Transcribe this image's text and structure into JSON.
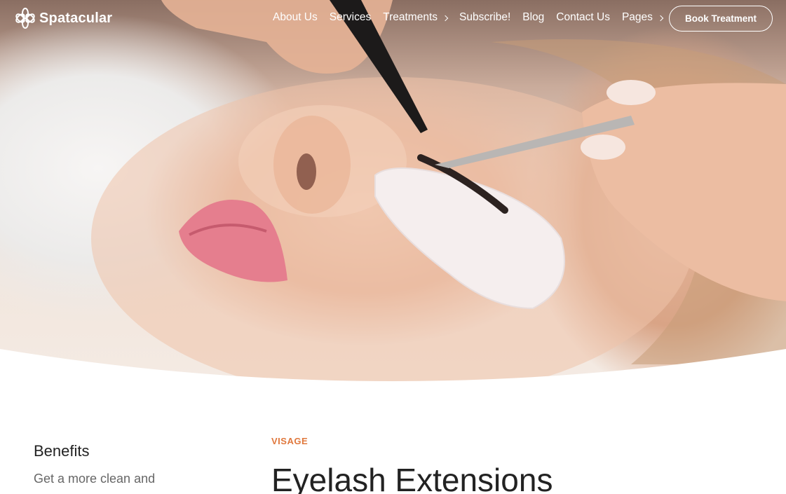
{
  "brand": {
    "name": "Spatacular",
    "logo_icon": "flower-logo-icon"
  },
  "nav": {
    "items": [
      {
        "label": "About Us",
        "has_submenu": false
      },
      {
        "label": "Services",
        "has_submenu": false
      },
      {
        "label": "Treatments",
        "has_submenu": true
      },
      {
        "label": "Subscribe!",
        "has_submenu": false
      },
      {
        "label": "Blog",
        "has_submenu": false
      },
      {
        "label": "Contact Us",
        "has_submenu": false
      },
      {
        "label": "Pages",
        "has_submenu": true
      }
    ],
    "cta_label": "Book Treatment"
  },
  "hero": {
    "image": "eyelash-extension-photo"
  },
  "sidebar": {
    "title": "Benefits",
    "text": "Get a more clean and"
  },
  "main": {
    "eyebrow": "VISAGE",
    "title": "Eyelash Extensions"
  },
  "colors": {
    "accent": "#e0783d",
    "heading": "#222222",
    "body_text": "#666666",
    "nav_text": "#ffffff"
  }
}
